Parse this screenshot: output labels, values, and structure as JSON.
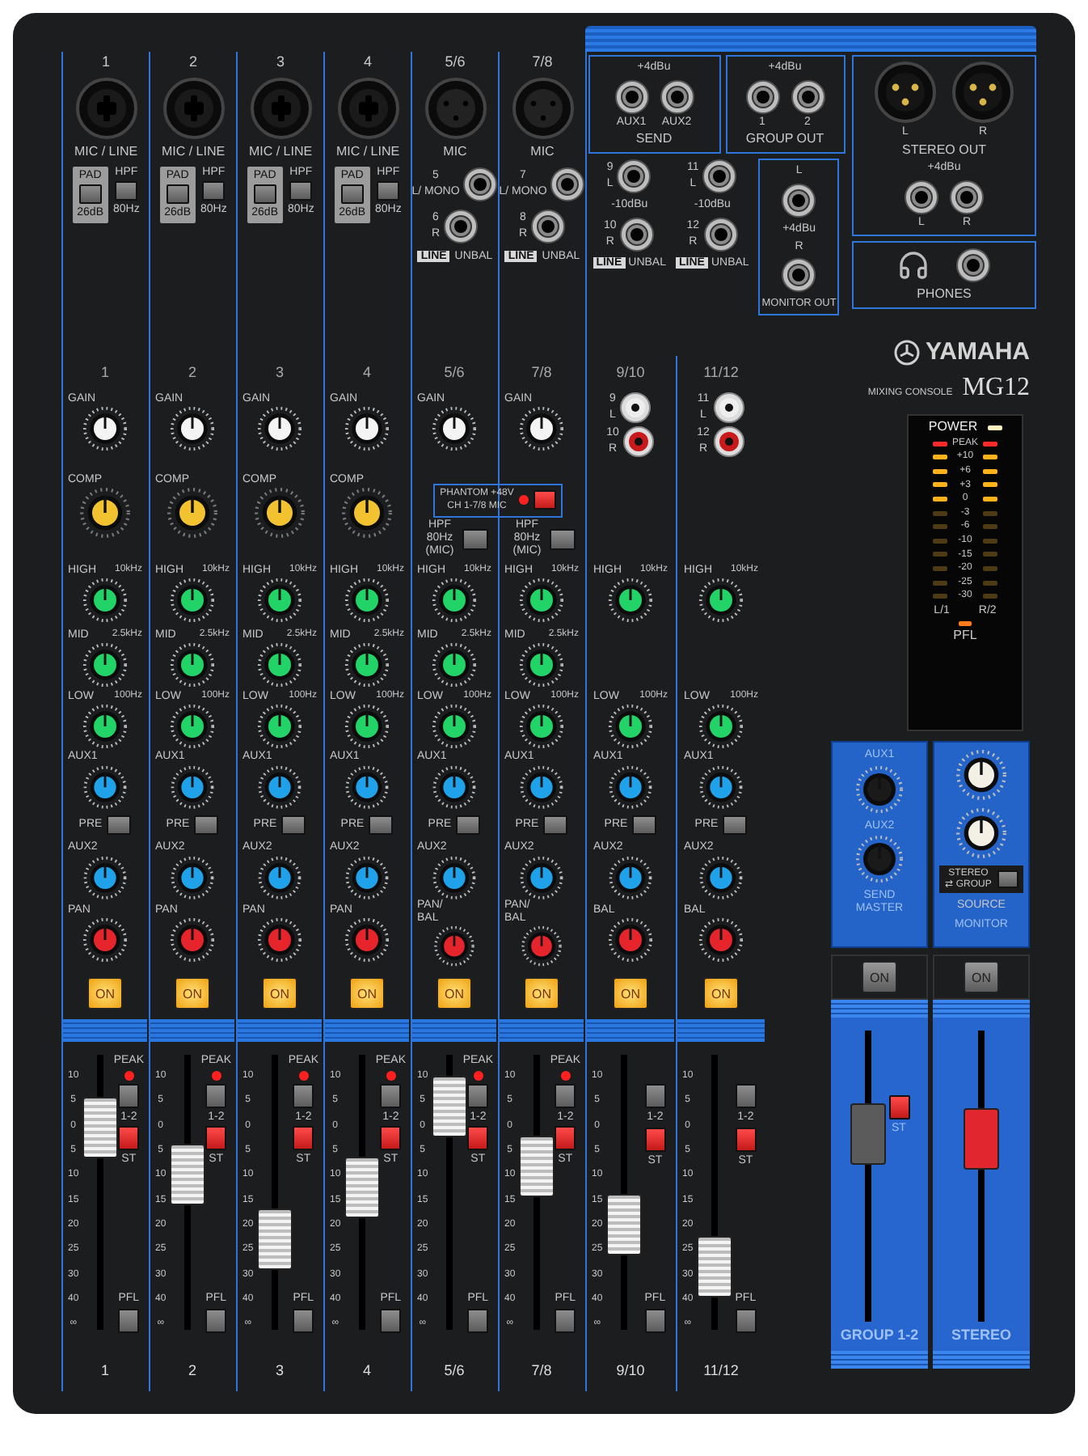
{
  "outputs": {
    "send": {
      "note": "+4dBu",
      "jacks": [
        "AUX1",
        "AUX2"
      ],
      "title": "SEND"
    },
    "group_out": {
      "note": "+4dBu",
      "jacks": [
        "1",
        "2"
      ],
      "title": "GROUP OUT"
    },
    "stereo_out": {
      "xlr": [
        "L",
        "R"
      ],
      "title": "STEREO OUT",
      "note": "+4dBu",
      "jacks": [
        "L",
        "R"
      ]
    },
    "monitor_out": {
      "jacks": [
        "L",
        "R"
      ],
      "note": "+4dBu",
      "title": "MONITOR OUT"
    },
    "phones": {
      "title": "PHONES"
    }
  },
  "phantom": {
    "label": "PHANTOM +48V",
    "sub": "CH 1-7/8 MIC",
    "on": true
  },
  "channels": [
    {
      "kind": "mono",
      "number": "1",
      "input": "MIC / LINE",
      "pad": {
        "label": "PAD",
        "value": "26dB"
      },
      "hpf": {
        "label": "HPF",
        "value": "80Hz"
      },
      "strip_number": "1",
      "knobs": [
        {
          "kind": "gain",
          "label": "GAIN",
          "color": "#f4f4f4"
        },
        {
          "kind": "comp",
          "label": "COMP",
          "color": "#f2c230"
        },
        {
          "kind": "high",
          "label": "HIGH",
          "note": "10kHz",
          "color": "#22d468"
        },
        {
          "kind": "mid",
          "label": "MID",
          "note": "2.5kHz",
          "color": "#22d468"
        },
        {
          "kind": "low",
          "label": "LOW",
          "note": "100Hz",
          "color": "#22d468"
        },
        {
          "kind": "aux1",
          "label": "AUX1",
          "color": "#1fa2ea"
        },
        {
          "kind": "aux2",
          "label": "AUX2",
          "color": "#1fa2ea"
        },
        {
          "kind": "pan",
          "label": "PAN",
          "color": "#e6242b"
        }
      ],
      "pre": "PRE",
      "on_button": {
        "label": "ON",
        "on": true
      },
      "peak": {
        "label": "PEAK",
        "lit": true
      },
      "fader": {
        "level": 0.8,
        "scale": [
          "10",
          "5",
          "0",
          "5",
          "10",
          "15",
          "20",
          "25",
          "30",
          "40",
          "∞"
        ]
      },
      "assign": "1-2",
      "stereo": "ST",
      "pfl": "PFL",
      "label": "1"
    },
    {
      "kind": "mono",
      "number": "2",
      "input": "MIC / LINE",
      "pad": {
        "label": "PAD",
        "value": "26dB"
      },
      "hpf": {
        "label": "HPF",
        "value": "80Hz"
      },
      "strip_number": "2",
      "knobs": [
        {
          "kind": "gain",
          "label": "GAIN",
          "color": "#f4f4f4"
        },
        {
          "kind": "comp",
          "label": "COMP",
          "color": "#f2c230"
        },
        {
          "kind": "high",
          "label": "HIGH",
          "note": "10kHz",
          "color": "#22d468"
        },
        {
          "kind": "mid",
          "label": "MID",
          "note": "2.5kHz",
          "color": "#22d468"
        },
        {
          "kind": "low",
          "label": "LOW",
          "note": "100Hz",
          "color": "#22d468"
        },
        {
          "kind": "aux1",
          "label": "AUX1",
          "color": "#1fa2ea"
        },
        {
          "kind": "aux2",
          "label": "AUX2",
          "color": "#1fa2ea"
        },
        {
          "kind": "pan",
          "label": "PAN",
          "color": "#e6242b"
        }
      ],
      "pre": "PRE",
      "on_button": {
        "label": "ON",
        "on": true
      },
      "peak": {
        "label": "PEAK",
        "lit": true
      },
      "fader": {
        "level": 0.58,
        "scale": [
          "10",
          "5",
          "0",
          "5",
          "10",
          "15",
          "20",
          "25",
          "30",
          "40",
          "∞"
        ]
      },
      "assign": "1-2",
      "stereo": "ST",
      "pfl": "PFL",
      "label": "2"
    },
    {
      "kind": "mono",
      "number": "3",
      "input": "MIC / LINE",
      "pad": {
        "label": "PAD",
        "value": "26dB"
      },
      "hpf": {
        "label": "HPF",
        "value": "80Hz"
      },
      "strip_number": "3",
      "knobs": [
        {
          "kind": "gain",
          "label": "GAIN",
          "color": "#f4f4f4"
        },
        {
          "kind": "comp",
          "label": "COMP",
          "color": "#f2c230"
        },
        {
          "kind": "high",
          "label": "HIGH",
          "note": "10kHz",
          "color": "#22d468"
        },
        {
          "kind": "mid",
          "label": "MID",
          "note": "2.5kHz",
          "color": "#22d468"
        },
        {
          "kind": "low",
          "label": "LOW",
          "note": "100Hz",
          "color": "#22d468"
        },
        {
          "kind": "aux1",
          "label": "AUX1",
          "color": "#1fa2ea"
        },
        {
          "kind": "aux2",
          "label": "AUX2",
          "color": "#1fa2ea"
        },
        {
          "kind": "pan",
          "label": "PAN",
          "color": "#e6242b"
        }
      ],
      "pre": "PRE",
      "on_button": {
        "label": "ON",
        "on": true
      },
      "peak": {
        "label": "PEAK",
        "lit": true
      },
      "fader": {
        "level": 0.28,
        "scale": [
          "10",
          "5",
          "0",
          "5",
          "10",
          "15",
          "20",
          "25",
          "30",
          "40",
          "∞"
        ]
      },
      "assign": "1-2",
      "stereo": "ST",
      "pfl": "PFL",
      "label": "3"
    },
    {
      "kind": "mono",
      "number": "4",
      "input": "MIC / LINE",
      "pad": {
        "label": "PAD",
        "value": "26dB"
      },
      "hpf": {
        "label": "HPF",
        "value": "80Hz"
      },
      "strip_number": "4",
      "knobs": [
        {
          "kind": "gain",
          "label": "GAIN",
          "color": "#f4f4f4"
        },
        {
          "kind": "comp",
          "label": "COMP",
          "color": "#f2c230"
        },
        {
          "kind": "high",
          "label": "HIGH",
          "note": "10kHz",
          "color": "#22d468"
        },
        {
          "kind": "mid",
          "label": "MID",
          "note": "2.5kHz",
          "color": "#22d468"
        },
        {
          "kind": "low",
          "label": "LOW",
          "note": "100Hz",
          "color": "#22d468"
        },
        {
          "kind": "aux1",
          "label": "AUX1",
          "color": "#1fa2ea"
        },
        {
          "kind": "aux2",
          "label": "AUX2",
          "color": "#1fa2ea"
        },
        {
          "kind": "pan",
          "label": "PAN",
          "color": "#e6242b"
        }
      ],
      "pre": "PRE",
      "on_button": {
        "label": "ON",
        "on": true
      },
      "peak": {
        "label": "PEAK",
        "lit": true
      },
      "fader": {
        "level": 0.52,
        "scale": [
          "10",
          "5",
          "0",
          "5",
          "10",
          "15",
          "20",
          "25",
          "30",
          "40",
          "∞"
        ]
      },
      "assign": "1-2",
      "stereo": "ST",
      "pfl": "PFL",
      "label": "4"
    },
    {
      "kind": "stereo_mic",
      "number": "5/6",
      "input": "MIC",
      "line_jacks": [
        {
          "number": "5",
          "side": "L/ MONO"
        },
        {
          "number": "6",
          "side": "R"
        }
      ],
      "line_tag": "LINE",
      "line_note": "UNBAL",
      "hpf": {
        "label": "HPF 80Hz (MIC)"
      },
      "strip_number": "5/6",
      "knobs": [
        {
          "kind": "gain",
          "label": "GAIN",
          "color": "#f4f4f4"
        },
        {
          "kind": "high",
          "label": "HIGH",
          "note": "10kHz",
          "color": "#22d468"
        },
        {
          "kind": "mid",
          "label": "MID",
          "note": "2.5kHz",
          "color": "#22d468"
        },
        {
          "kind": "low",
          "label": "LOW",
          "note": "100Hz",
          "color": "#22d468"
        },
        {
          "kind": "aux1",
          "label": "AUX1",
          "color": "#1fa2ea"
        },
        {
          "kind": "aux2",
          "label": "AUX2",
          "color": "#1fa2ea"
        },
        {
          "kind": "pan",
          "label": "PAN/ BAL",
          "color": "#e6242b"
        }
      ],
      "pre": "PRE",
      "on_button": {
        "label": "ON",
        "on": true
      },
      "peak": {
        "label": "PEAK",
        "lit": true
      },
      "fader": {
        "level": 0.9,
        "scale": [
          "10",
          "5",
          "0",
          "5",
          "10",
          "15",
          "20",
          "25",
          "30",
          "40",
          "∞"
        ]
      },
      "assign": "1-2",
      "stereo": "ST",
      "pfl": "PFL",
      "label": "5/6"
    },
    {
      "kind": "stereo_mic",
      "number": "7/8",
      "input": "MIC",
      "line_jacks": [
        {
          "number": "7",
          "side": "L/ MONO"
        },
        {
          "number": "8",
          "side": "R"
        }
      ],
      "line_tag": "LINE",
      "line_note": "UNBAL",
      "hpf": {
        "label": "HPF 80Hz (MIC)"
      },
      "strip_number": "7/8",
      "knobs": [
        {
          "kind": "gain",
          "label": "GAIN",
          "color": "#f4f4f4"
        },
        {
          "kind": "high",
          "label": "HIGH",
          "note": "10kHz",
          "color": "#22d468"
        },
        {
          "kind": "mid",
          "label": "MID",
          "note": "2.5kHz",
          "color": "#22d468"
        },
        {
          "kind": "low",
          "label": "LOW",
          "note": "100Hz",
          "color": "#22d468"
        },
        {
          "kind": "aux1",
          "label": "AUX1",
          "color": "#1fa2ea"
        },
        {
          "kind": "aux2",
          "label": "AUX2",
          "color": "#1fa2ea"
        },
        {
          "kind": "pan",
          "label": "PAN/ BAL",
          "color": "#e6242b"
        }
      ],
      "pre": "PRE",
      "on_button": {
        "label": "ON",
        "on": true
      },
      "peak": {
        "label": "PEAK",
        "lit": true
      },
      "fader": {
        "level": 0.62,
        "scale": [
          "10",
          "5",
          "0",
          "5",
          "10",
          "15",
          "20",
          "25",
          "30",
          "40",
          "∞"
        ]
      },
      "assign": "1-2",
      "stereo": "ST",
      "pfl": "PFL",
      "label": "7/8"
    },
    {
      "kind": "stereo",
      "line_jacks": [
        {
          "number": "9",
          "side": "L"
        },
        {
          "number": "10",
          "side": "R"
        }
      ],
      "line_level": "-10dBu",
      "line_tag": "LINE",
      "line_note": "UNBAL",
      "rca": [
        {
          "number": "9",
          "side": "L"
        },
        {
          "number": "10",
          "side": "R"
        }
      ],
      "strip_number": "9/10",
      "knobs": [
        {
          "kind": "high",
          "label": "HIGH",
          "note": "10kHz",
          "color": "#22d468"
        },
        {
          "kind": "low",
          "label": "LOW",
          "note": "100Hz",
          "color": "#22d468"
        },
        {
          "kind": "aux1",
          "label": "AUX1",
          "color": "#1fa2ea"
        },
        {
          "kind": "aux2",
          "label": "AUX2",
          "color": "#1fa2ea"
        },
        {
          "kind": "pan",
          "label": "BAL",
          "color": "#e6242b"
        }
      ],
      "pre": "PRE",
      "on_button": {
        "label": "ON",
        "on": true
      },
      "fader": {
        "level": 0.35,
        "scale": [
          "10",
          "5",
          "0",
          "5",
          "10",
          "15",
          "20",
          "25",
          "30",
          "40",
          "∞"
        ]
      },
      "assign": "1-2",
      "stereo": "ST",
      "pfl": "PFL",
      "label": "9/10"
    },
    {
      "kind": "stereo",
      "line_jacks": [
        {
          "number": "11",
          "side": "L"
        },
        {
          "number": "12",
          "side": "R"
        }
      ],
      "line_level": "-10dBu",
      "line_tag": "LINE",
      "line_note": "UNBAL",
      "rca": [
        {
          "number": "11",
          "side": "L"
        },
        {
          "number": "12",
          "side": "R"
        }
      ],
      "strip_number": "11/12",
      "knobs": [
        {
          "kind": "high",
          "label": "HIGH",
          "note": "10kHz",
          "color": "#22d468"
        },
        {
          "kind": "low",
          "label": "LOW",
          "note": "100Hz",
          "color": "#22d468"
        },
        {
          "kind": "aux1",
          "label": "AUX1",
          "color": "#1fa2ea"
        },
        {
          "kind": "aux2",
          "label": "AUX2",
          "color": "#1fa2ea"
        },
        {
          "kind": "pan",
          "label": "BAL",
          "color": "#e6242b"
        }
      ],
      "pre": "PRE",
      "on_button": {
        "label": "ON",
        "on": true
      },
      "fader": {
        "level": 0.15,
        "scale": [
          "10",
          "5",
          "0",
          "5",
          "10",
          "15",
          "20",
          "25",
          "30",
          "40",
          "∞"
        ]
      },
      "assign": "1-2",
      "stereo": "ST",
      "pfl": "PFL",
      "label": "11/12"
    }
  ],
  "brand": {
    "name": "YAMAHA",
    "subtitle": "MIXING CONSOLE",
    "model": "MG12"
  },
  "power": {
    "label": "POWER",
    "on": true
  },
  "meter": {
    "segments": [
      {
        "label": "PEAK",
        "kind": "peak",
        "lit": true
      },
      {
        "label": "+10",
        "kind": "level",
        "lit": true
      },
      {
        "label": "+6",
        "kind": "level",
        "lit": true
      },
      {
        "label": "+3",
        "kind": "level",
        "lit": true
      },
      {
        "label": "0",
        "kind": "level",
        "lit": true
      },
      {
        "label": "-3",
        "kind": "level",
        "lit": false
      },
      {
        "label": "-6",
        "kind": "level",
        "lit": false
      },
      {
        "label": "-10",
        "kind": "level",
        "lit": false
      },
      {
        "label": "-15",
        "kind": "level",
        "lit": false
      },
      {
        "label": "-20",
        "kind": "level",
        "lit": false
      },
      {
        "label": "-25",
        "kind": "level",
        "lit": false
      },
      {
        "label": "-30",
        "kind": "level",
        "lit": false
      }
    ],
    "left": "L/1",
    "right": "R/2",
    "pfl": {
      "label": "PFL",
      "lit": true
    }
  },
  "send_master": {
    "knobs": [
      {
        "label": "AUX1"
      },
      {
        "label": "AUX2"
      }
    ],
    "title": "SEND MASTER"
  },
  "monitor": {
    "switch_label": "STEREO ⇄ GROUP",
    "switch_pressed": false,
    "source": "SOURCE",
    "title": "MONITOR"
  },
  "masters": [
    {
      "label": "GROUP 1-2",
      "on_button": {
        "label": "ON",
        "on": false
      },
      "level": 0.68,
      "color": "#5b5b5b",
      "stereo": "ST"
    },
    {
      "label": "STEREO",
      "on_button": {
        "label": "ON",
        "on": false
      },
      "level": 0.66,
      "color": "#e2262f"
    }
  ]
}
